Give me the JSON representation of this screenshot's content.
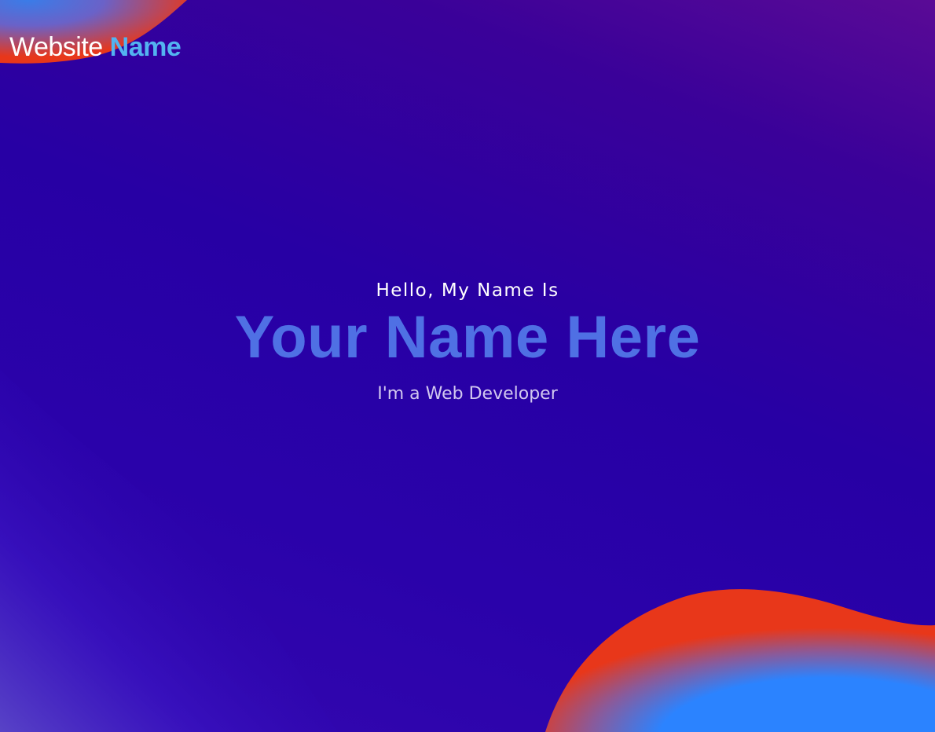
{
  "header": {
    "brand_primary": "Website",
    "brand_accent": "Name"
  },
  "hero": {
    "greeting": "Hello, My Name Is",
    "name": "Your Name Here",
    "role": "I'm a Web Developer"
  },
  "colors": {
    "background": "#2a00a6",
    "brand_accent": "#53b3f0",
    "name_text": "#4f70e4",
    "blob_orange": "#e8371a",
    "blob_blue": "#2b83ff"
  }
}
